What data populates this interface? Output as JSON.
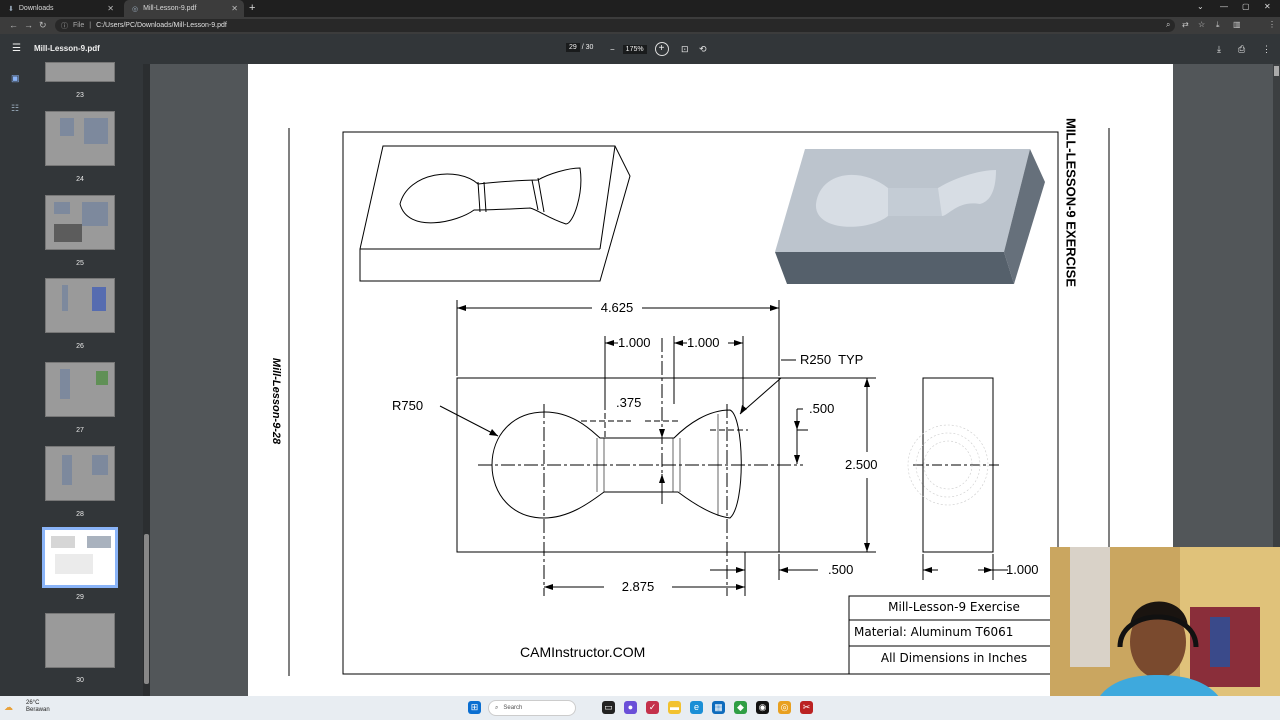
{
  "browser": {
    "tabs": [
      {
        "label": "Downloads",
        "active": false
      },
      {
        "label": "Mill-Lesson-9.pdf",
        "active": true
      }
    ],
    "address": {
      "scheme": "File",
      "path": "C:/Users/PC/Downloads/Mill-Lesson-9.pdf"
    },
    "profile_initial": "D"
  },
  "pdf": {
    "filename": "Mill-Lesson-9.pdf",
    "current_page": "29",
    "total_pages": "/ 30",
    "zoom": "175%"
  },
  "thumbnails": [
    {
      "label": "23"
    },
    {
      "label": "24"
    },
    {
      "label": "25"
    },
    {
      "label": "26"
    },
    {
      "label": "27"
    },
    {
      "label": "28"
    },
    {
      "label": "29",
      "selected": true
    },
    {
      "label": "30"
    }
  ],
  "drawing": {
    "side_label": "Mill-Lesson-9-28",
    "title_vertical": "MILL-LESSON-9 EXERCISE",
    "dims": {
      "overall_length": "4.625",
      "width_a": "1.000",
      "width_b": "1.000",
      "r_typ": "R250  TYP",
      "r_large": "R750",
      "depth_375": ".375",
      "gap_500_top": ".500",
      "height": "2.500",
      "spacing": "2.875",
      "offset_500": ".500",
      "thickness": "1.000"
    },
    "website": "CAMInstructor.COM",
    "title_block": {
      "name": "Mill-Lesson-9 Exercise",
      "material": "Material: Aluminum T6061",
      "units": "All Dimensions in Inches"
    }
  },
  "taskbar": {
    "temperature": "26°C",
    "weather": "Berawan",
    "search_placeholder": "Search"
  },
  "colors": {
    "accent": "#8ab4f8",
    "toolbar": "#323639",
    "viewer_bg": "#525659"
  }
}
